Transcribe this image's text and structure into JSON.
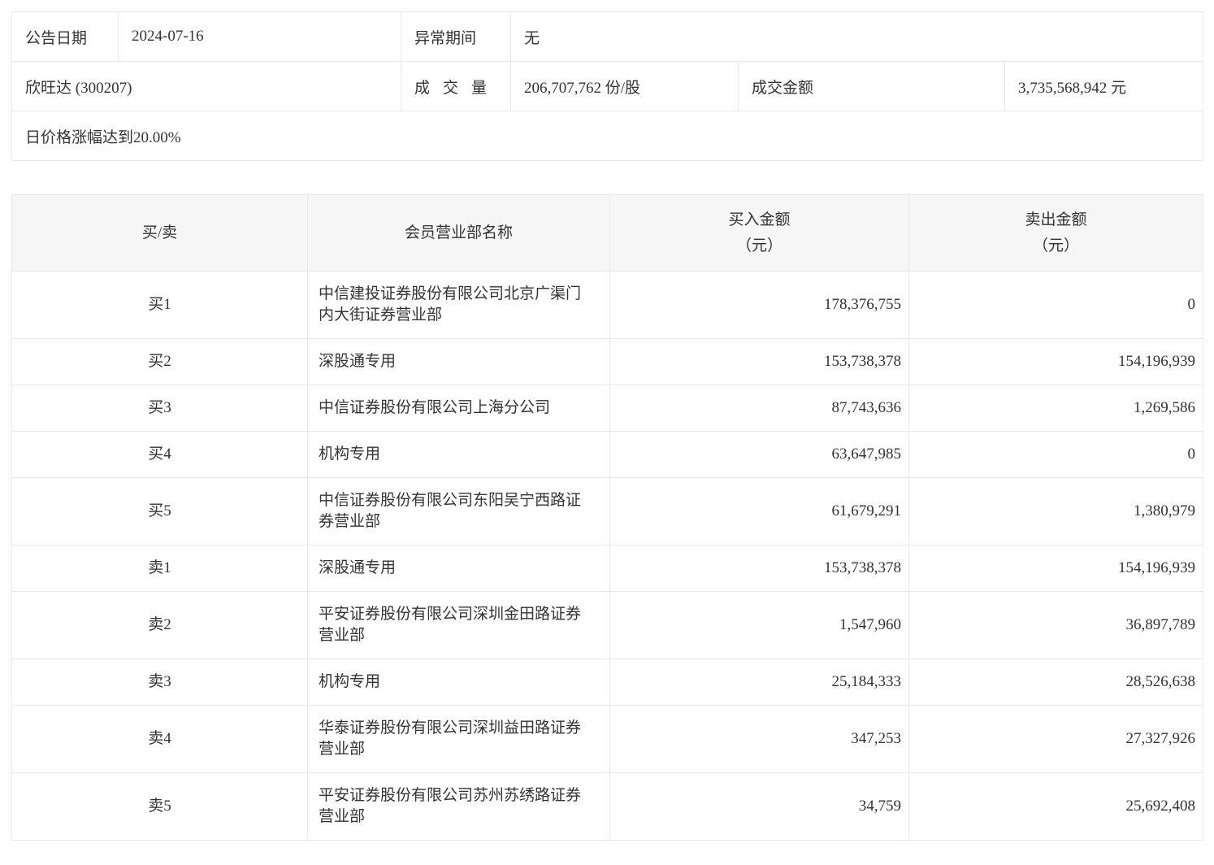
{
  "summary": {
    "announce_date_label": "公告日期",
    "announce_date": "2024-07-16",
    "abnormal_period_label": "异常期间",
    "abnormal_period": "无",
    "stock": "欣旺达 (300207)",
    "volume_label": "成交量",
    "volume": "206,707,762 份/股",
    "turnover_label": "成交金额",
    "turnover": "3,735,568,942 元",
    "note": "日价格涨幅达到20.00%"
  },
  "table": {
    "headers": {
      "side": "买/卖",
      "branch": "会员营业部名称",
      "buy_line1": "买入金额",
      "buy_line2": "（元）",
      "sell_line1": "卖出金额",
      "sell_line2": "（元）"
    },
    "rows": [
      {
        "side": "买1",
        "branch": "中信建投证券股份有限公司北京广渠门内大街证券营业部",
        "buy": "178,376,755",
        "sell": "0"
      },
      {
        "side": "买2",
        "branch": "深股通专用",
        "buy": "153,738,378",
        "sell": "154,196,939"
      },
      {
        "side": "买3",
        "branch": "中信证券股份有限公司上海分公司",
        "buy": "87,743,636",
        "sell": "1,269,586"
      },
      {
        "side": "买4",
        "branch": "机构专用",
        "buy": "63,647,985",
        "sell": "0"
      },
      {
        "side": "买5",
        "branch": "中信证券股份有限公司东阳吴宁西路证券营业部",
        "buy": "61,679,291",
        "sell": "1,380,979"
      },
      {
        "side": "卖1",
        "branch": "深股通专用",
        "buy": "153,738,378",
        "sell": "154,196,939"
      },
      {
        "side": "卖2",
        "branch": "平安证券股份有限公司深圳金田路证券营业部",
        "buy": "1,547,960",
        "sell": "36,897,789"
      },
      {
        "side": "卖3",
        "branch": "机构专用",
        "buy": "25,184,333",
        "sell": "28,526,638"
      },
      {
        "side": "卖4",
        "branch": "华泰证券股份有限公司深圳益田路证券营业部",
        "buy": "347,253",
        "sell": "27,327,926"
      },
      {
        "side": "卖5",
        "branch": "平安证券股份有限公司苏州苏绣路证券营业部",
        "buy": "34,759",
        "sell": "25,692,408"
      }
    ]
  },
  "colors": {
    "text": "#333333",
    "border": "#e8e8e8",
    "header_bg": "#f6f6f6",
    "page_bg": "#ffffff"
  }
}
